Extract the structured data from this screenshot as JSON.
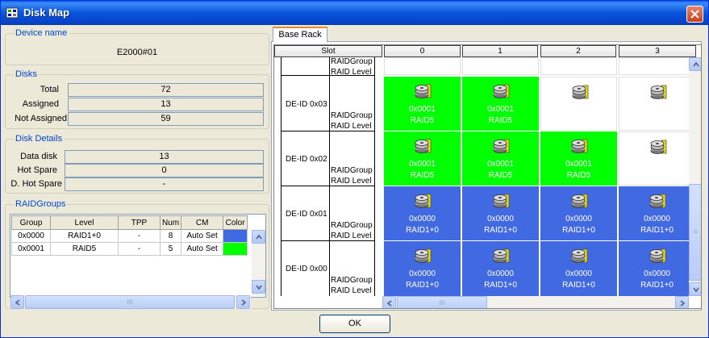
{
  "window": {
    "title": "Disk Map"
  },
  "device": {
    "section": "Device name",
    "value": "E2000#01"
  },
  "disks": {
    "section": "Disks",
    "rows": [
      {
        "label": "Total",
        "value": "72"
      },
      {
        "label": "Assigned",
        "value": "13"
      },
      {
        "label": "Not Assigned",
        "value": "59"
      }
    ]
  },
  "disk_details": {
    "section": "Disk Details",
    "rows": [
      {
        "label": "Data disk",
        "value": "13"
      },
      {
        "label": "Hot Spare",
        "value": "0"
      },
      {
        "label": "D. Hot Spare",
        "value": "-"
      }
    ]
  },
  "raidgroups": {
    "section": "RAIDGroups",
    "headers": [
      "Group",
      "Level",
      "TPP",
      "Num",
      "CM",
      "Color"
    ],
    "rows": [
      {
        "group": "0x0000",
        "level": "RAID1+0",
        "tpp": "-",
        "num": "8",
        "cm": "Auto Set",
        "color": "#4169e1"
      },
      {
        "group": "0x0001",
        "level": "RAID5",
        "tpp": "-",
        "num": "5",
        "cm": "Auto Set",
        "color": "#00ff00"
      }
    ],
    "hscroll_label": "III"
  },
  "tab": {
    "label": "Base Rack"
  },
  "map": {
    "slot_header": "Slot",
    "columns": [
      "0",
      "1",
      "2",
      "3"
    ],
    "raidgroup_label": "RAIDGroup",
    "raidlevel_label": "RAID Level",
    "rows": [
      {
        "de": "",
        "cells": [
          {
            "c": "white",
            "id": "",
            "lvl": "",
            "icon": false
          },
          {
            "c": "white",
            "id": "",
            "lvl": "",
            "icon": false
          },
          {
            "c": "white",
            "id": "",
            "lvl": "",
            "icon": false
          },
          {
            "c": "white",
            "id": "",
            "lvl": "",
            "icon": false
          }
        ]
      },
      {
        "de": "DE-ID 0x03",
        "cells": [
          {
            "c": "green",
            "id": "0x0001",
            "lvl": "RAID5",
            "icon": true
          },
          {
            "c": "green",
            "id": "0x0001",
            "lvl": "RAID5",
            "icon": true
          },
          {
            "c": "white",
            "id": "",
            "lvl": "",
            "icon": true
          },
          {
            "c": "white",
            "id": "",
            "lvl": "",
            "icon": true
          }
        ]
      },
      {
        "de": "DE-ID 0x02",
        "cells": [
          {
            "c": "green",
            "id": "0x0001",
            "lvl": "RAID5",
            "icon": true
          },
          {
            "c": "green",
            "id": "0x0001",
            "lvl": "RAID5",
            "icon": true
          },
          {
            "c": "green",
            "id": "0x0001",
            "lvl": "RAID5",
            "icon": true
          },
          {
            "c": "white",
            "id": "",
            "lvl": "",
            "icon": true
          }
        ]
      },
      {
        "de": "DE-ID 0x01",
        "cells": [
          {
            "c": "blue",
            "id": "0x0000",
            "lvl": "RAID1+0",
            "icon": true
          },
          {
            "c": "blue",
            "id": "0x0000",
            "lvl": "RAID1+0",
            "icon": true
          },
          {
            "c": "blue",
            "id": "0x0000",
            "lvl": "RAID1+0",
            "icon": true
          },
          {
            "c": "blue",
            "id": "0x0000",
            "lvl": "RAID1+0",
            "icon": true
          }
        ]
      },
      {
        "de": "DE-ID 0x00",
        "cells": [
          {
            "c": "blue",
            "id": "0x0000",
            "lvl": "RAID1+0",
            "icon": true
          },
          {
            "c": "blue",
            "id": "0x0000",
            "lvl": "RAID1+0",
            "icon": true
          },
          {
            "c": "blue",
            "id": "0x0000",
            "lvl": "RAID1+0",
            "icon": true
          },
          {
            "c": "blue",
            "id": "0x0000",
            "lvl": "RAID1+0",
            "icon": true
          }
        ]
      }
    ],
    "hscroll_label": "III",
    "vscroll_label": "≡"
  },
  "buttons": {
    "ok": "OK"
  },
  "icons": {
    "title": "disk-map-icon",
    "close": "close-icon",
    "disk": "hard-disk-icon"
  },
  "colors": {
    "raid5": "#00ff00",
    "raid10": "#4169e1",
    "title_bar": "#0855dd",
    "section_title": "#0046d5"
  }
}
